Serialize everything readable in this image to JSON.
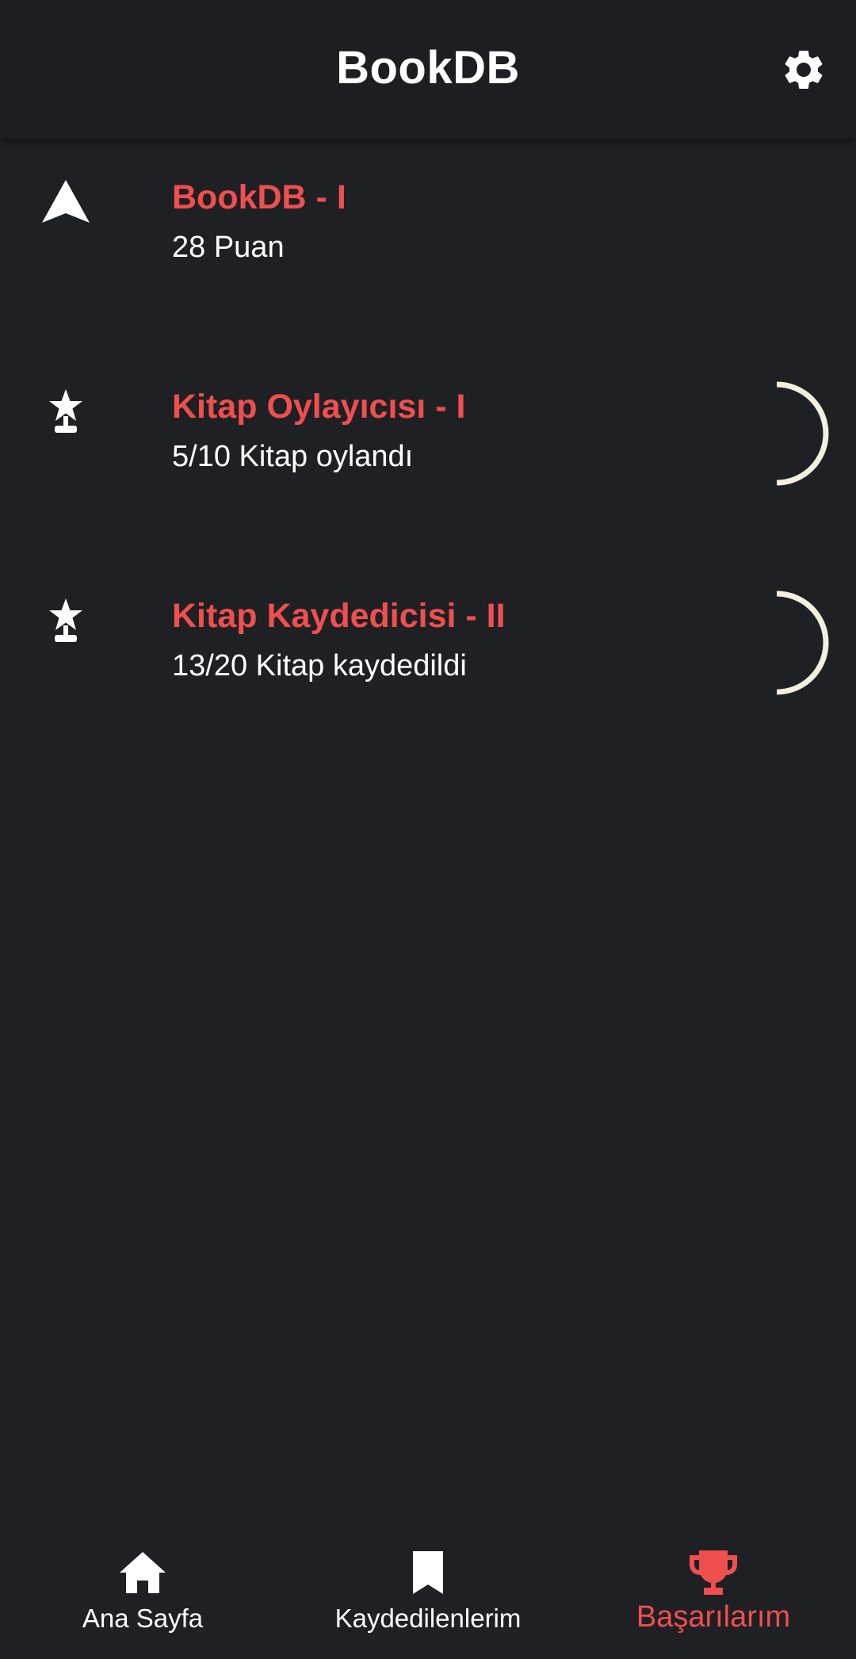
{
  "app_title": "BookDB",
  "colors": {
    "accent": "#ef4f4f",
    "background": "#1f2024",
    "ring": "#f3f0df"
  },
  "icons": {
    "settings": "gear-icon"
  },
  "achievements": [
    {
      "icon": "rank-chevron-icon",
      "title": "BookDB - I",
      "subtitle": "28 Puan",
      "progress": null
    },
    {
      "icon": "trophy-star-icon",
      "title": "Kitap Oylayıcısı - I",
      "subtitle": "5/10 Kitap oylandı",
      "progress": 0.5
    },
    {
      "icon": "trophy-star-icon",
      "title": "Kitap Kaydedicisi - II",
      "subtitle": "13/20 Kitap kaydedildi",
      "progress": 0.65
    }
  ],
  "bottom_nav": [
    {
      "label": "Ana Sayfa",
      "icon": "home-icon",
      "active": false
    },
    {
      "label": "Kaydedilenlerim",
      "icon": "bookmark-icon",
      "active": false
    },
    {
      "label": "Başarılarım",
      "icon": "trophy-icon",
      "active": true
    }
  ]
}
